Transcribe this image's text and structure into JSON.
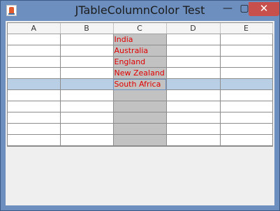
{
  "window": {
    "title": "JTableColumnColor Test",
    "controls": {
      "minimize": "—",
      "maximize": "▢",
      "close": "✕"
    }
  },
  "table": {
    "columns": [
      "A",
      "B",
      "C",
      "D",
      "E"
    ],
    "rows": [
      [
        "",
        "",
        "India",
        "",
        ""
      ],
      [
        "",
        "",
        "Australia",
        "",
        ""
      ],
      [
        "",
        "",
        "England",
        "",
        ""
      ],
      [
        "",
        "",
        "New Zealand",
        "",
        ""
      ],
      [
        "",
        "",
        "South Africa",
        "",
        ""
      ],
      [
        "",
        "",
        "",
        "",
        ""
      ],
      [
        "",
        "",
        "",
        "",
        ""
      ],
      [
        "",
        "",
        "",
        "",
        ""
      ],
      [
        "",
        "",
        "",
        "",
        ""
      ],
      [
        "",
        "",
        "",
        "",
        ""
      ]
    ],
    "selected_row_index": 4,
    "colored_column": "C",
    "colored_column_bg": "#c2c2c2",
    "colored_column_text": "#e00000",
    "selection_color": "#b8cfe5"
  }
}
